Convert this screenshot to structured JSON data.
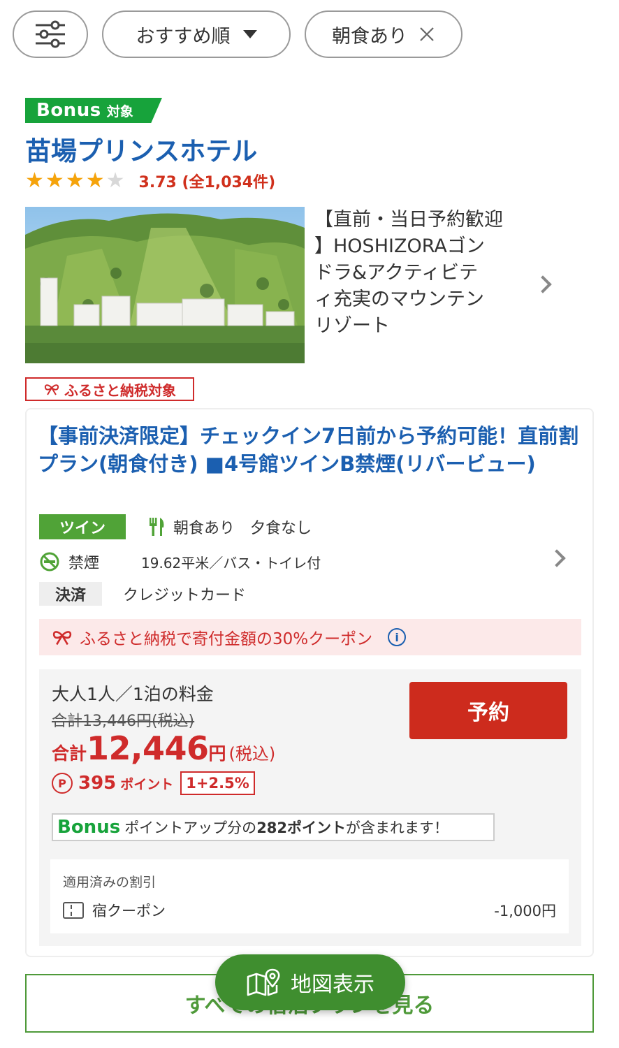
{
  "filters": {
    "sort_label": "おすすめ順",
    "tag_label": "朝食あり"
  },
  "hotel": {
    "bonus_word": "Bonus",
    "bonus_sub": "対象",
    "name": "苗場プリンスホテル",
    "rating": 3.73,
    "rating_text": "3.73 (全1,034件)",
    "catch_lines": [
      "【直前・当日予約歓迎",
      "】HOSHIZORAゴン",
      "ドラ&アクティビテ",
      "ィ充実のマウンテン",
      "リゾート"
    ],
    "furusato_badge": "ふるさと納税対象"
  },
  "plan": {
    "title": "【事前決済限定】チェックイン7日前から予約可能！直前割プラン(朝食付き) ■4号館ツインB禁煙(リバービュー)",
    "room_type": "ツイン",
    "breakfast": "朝食あり",
    "dinner": "夕食なし",
    "smoking": "禁煙",
    "room_size": "19.62平米／バス・トイレ付",
    "payment_label": "決済",
    "payment_value": "クレジットカード",
    "coupon_banner": "ふるさと納税で寄付金額の30%クーポン"
  },
  "price": {
    "label": "大人1人／1泊の料金",
    "original": "合計13,446円(税込)",
    "total_prefix": "合計",
    "total_value": "12,446",
    "total_yen": "円",
    "total_tax": "(税込)",
    "points_mark": "P",
    "points": "395",
    "points_unit": "ポイント",
    "points_rate": "1+2.5%",
    "reserve_button": "予約",
    "bonus_word": "Bonus",
    "bonus_note_prefix": "ポイントアップ分の",
    "bonus_note_points": "282ポイント",
    "bonus_note_suffix": "が含まれます！"
  },
  "discount": {
    "title": "適用済みの割引",
    "name": "宿クーポン",
    "amount": "-1,000円"
  },
  "bottom": {
    "see_all": "すべての宿泊プランを見る",
    "map_button": "地図表示"
  },
  "colors": {
    "link_blue": "#1b5fb0",
    "bonus_green": "#17a33b",
    "accent_red": "#cd2b1d",
    "map_green": "#3f8e2f"
  }
}
